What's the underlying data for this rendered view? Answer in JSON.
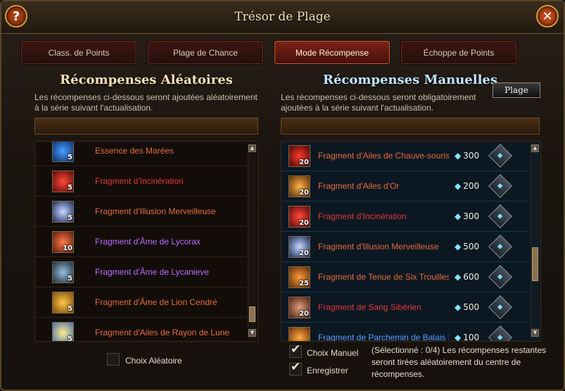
{
  "window": {
    "title": "Trésor de Plage",
    "help_glyph": "?",
    "close_glyph": "✕"
  },
  "tabs": [
    {
      "label": "Class. de Points",
      "active": false
    },
    {
      "label": "Plage de Chance",
      "active": false
    },
    {
      "label": "Mode Récompense",
      "active": true
    },
    {
      "label": "Échoppe de Points",
      "active": false
    }
  ],
  "left_panel": {
    "heading": "Récompenses Aléatoires",
    "description": "Les récompenses ci-dessous seront ajoutées aléatoirement à la série suivant l'actualisation.",
    "items": [
      {
        "name": "Essence des Marées",
        "count": "5",
        "icon": "tide-essence-icon",
        "color": "#e46b3c"
      },
      {
        "name": "Fragment d'Incinération",
        "count": "5",
        "icon": "incineration-fragment-icon",
        "color": "#e0363a"
      },
      {
        "name": "Fragment d'Illusion Merveilleuse",
        "count": "5",
        "icon": "illusion-fragment-icon",
        "color": "#e46b3c"
      },
      {
        "name": "Fragment d'Âme de Lycorax",
        "count": "10",
        "icon": "lycorax-soul-icon",
        "color": "#b96bff"
      },
      {
        "name": "Fragment d'Âme de Lycanieve",
        "count": "5",
        "icon": "lycanieve-soul-icon",
        "color": "#b96bff"
      },
      {
        "name": "Fragment d'Âme de Lion Cendré",
        "count": "5",
        "icon": "ash-lion-soul-icon",
        "color": "#e46b3c"
      },
      {
        "name": "Fragment d'Ailes de Rayon de Lune",
        "count": "5",
        "icon": "moonbeam-wings-icon",
        "color": "#e46b3c"
      }
    ],
    "random_choice_label": "Choix Aléatoire",
    "random_choice_checked": false
  },
  "right_panel": {
    "heading": "Récompenses Manuelles",
    "description": "Les récompenses ci-dessous seront obligatoirement ajoutées à la série suivant l'actualisation.",
    "plage_button": "Plage",
    "items": [
      {
        "name": "Fragment d'Ailes de Chauve-souris",
        "count": "20",
        "price": "300",
        "icon": "bat-wings-icon",
        "color": "#e46b3c"
      },
      {
        "name": "Fragment d'Ailes d'Or",
        "count": "20",
        "price": "200",
        "icon": "golden-wings-icon",
        "color": "#e46b3c"
      },
      {
        "name": "Fragment d'Incinération",
        "count": "20",
        "price": "300",
        "icon": "incineration-fragment-icon",
        "color": "#e0363a"
      },
      {
        "name": "Fragment d'Illusion Merveilleuse",
        "count": "20",
        "price": "500",
        "icon": "illusion-fragment-icon",
        "color": "#e46b3c"
      },
      {
        "name": "Fragment de Tenue de Six Trouilles",
        "count": "25",
        "price": "600",
        "icon": "six-fears-outfit-icon",
        "color": "#e46b3c"
      },
      {
        "name": "Fragment de Sang Sibérien",
        "count": "20",
        "price": "500",
        "icon": "siberian-blood-icon",
        "color": "#e0363a"
      },
      {
        "name": "Fragment de Parchemin de Balais M",
        "count": "",
        "price": "100",
        "icon": "broom-scroll-icon",
        "color": "#5a9cff"
      }
    ],
    "manual_choice_label": "Choix Manuel",
    "manual_choice_checked": true,
    "save_label": "Enregistrer",
    "save_checked": true,
    "note": "(Sélectionné : 0/4) Les récompenses restantes seront tirées aléatoirement du centre de récompenses."
  },
  "colors": {
    "accent_tab_active": "#7a2217",
    "gem": "#7fe6ff"
  }
}
